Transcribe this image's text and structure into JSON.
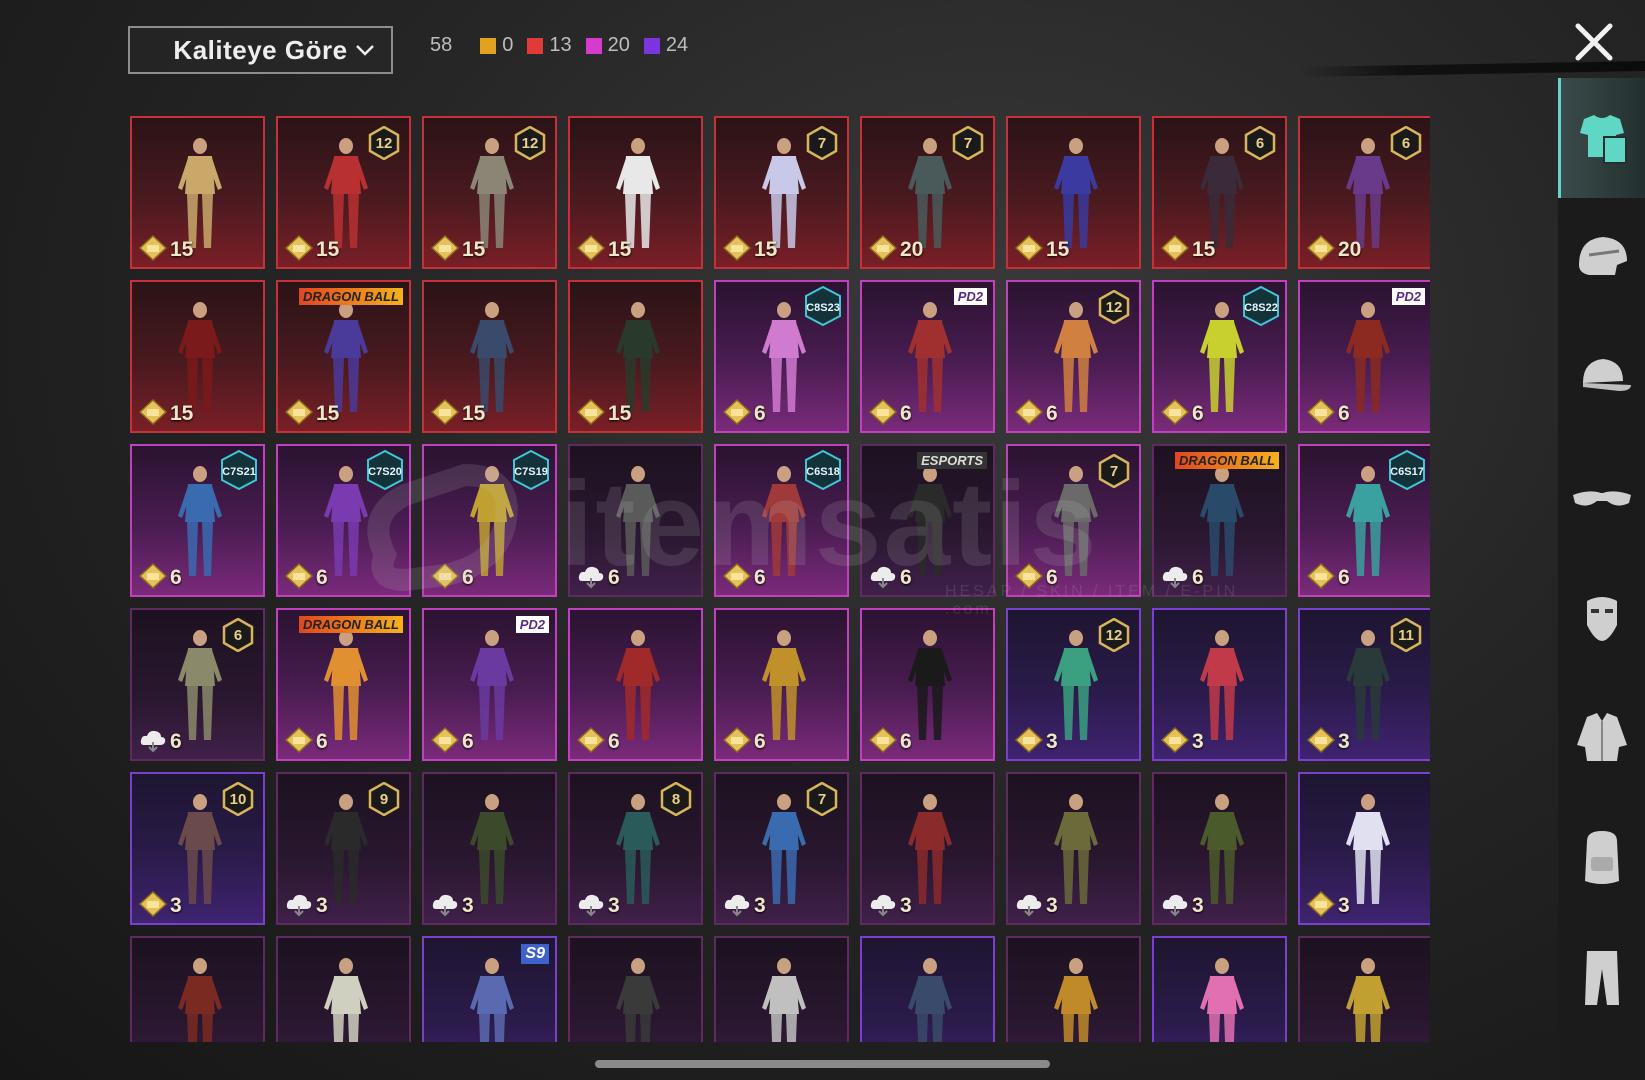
{
  "sort": {
    "label": "Kaliteye Göre"
  },
  "counts": {
    "total": "58",
    "tiers": [
      {
        "color": "#e2a11f",
        "value": "0"
      },
      {
        "color": "#e03a3a",
        "value": "13"
      },
      {
        "color": "#d63ad0",
        "value": "20"
      },
      {
        "color": "#7b35e0",
        "value": "24"
      }
    ]
  },
  "watermark": {
    "text": "itemsatis",
    "sub": "HESAP / SKIN / ITEM / E-PIN .com"
  },
  "items": [
    {
      "rarity": "red",
      "currency": "gold",
      "value": "15",
      "badge": "",
      "outfit": "#c9a86a"
    },
    {
      "rarity": "red",
      "currency": "gold",
      "value": "15",
      "badge": "12",
      "outfit": "#b83030"
    },
    {
      "rarity": "red",
      "currency": "gold",
      "value": "15",
      "badge": "12",
      "outfit": "#8a8575"
    },
    {
      "rarity": "red",
      "currency": "gold",
      "value": "15",
      "badge": "",
      "outfit": "#e8e8e8"
    },
    {
      "rarity": "red",
      "currency": "gold",
      "value": "15",
      "badge": "7",
      "outfit": "#c8c8e8"
    },
    {
      "rarity": "red",
      "currency": "gold",
      "value": "20",
      "badge": "7",
      "outfit": "#4a5a5a"
    },
    {
      "rarity": "red",
      "currency": "gold",
      "value": "15",
      "badge": "",
      "outfit": "#3a3aa0"
    },
    {
      "rarity": "red",
      "currency": "gold",
      "value": "15",
      "badge": "6",
      "outfit": "#3a2a3a"
    },
    {
      "rarity": "red",
      "currency": "gold",
      "value": "20",
      "badge": "6",
      "outfit": "#6a3a8a"
    },
    {
      "rarity": "red",
      "currency": "gold",
      "value": "15",
      "badge": "",
      "outfit": "#7a1a1a"
    },
    {
      "rarity": "red",
      "currency": "gold",
      "value": "15",
      "tag": "DRAGON BALL",
      "tagType": "dbs",
      "outfit": "#4a3a9a"
    },
    {
      "rarity": "red",
      "currency": "gold",
      "value": "15",
      "badge": "",
      "outfit": "#3a4a6a"
    },
    {
      "rarity": "red",
      "currency": "gold",
      "value": "15",
      "badge": "",
      "outfit": "#2a3a2a"
    },
    {
      "rarity": "magenta",
      "currency": "gold",
      "value": "6",
      "hex": "C8S23",
      "outfit": "#d07ad0"
    },
    {
      "rarity": "magenta",
      "currency": "gold",
      "value": "6",
      "tag": "PD2",
      "tagType": "pd",
      "outfit": "#a03030"
    },
    {
      "rarity": "magenta",
      "currency": "gold",
      "value": "6",
      "badge": "12",
      "outfit": "#d08040"
    },
    {
      "rarity": "magenta",
      "currency": "gold",
      "value": "6",
      "hex": "C8S22",
      "outfit": "#c8d030"
    },
    {
      "rarity": "magenta",
      "currency": "gold",
      "value": "6",
      "tag": "PD2",
      "tagType": "pd",
      "outfit": "#8a2a20"
    },
    {
      "rarity": "magenta",
      "currency": "gold",
      "value": "6",
      "hex": "C7S21",
      "outfit": "#3a6ab0"
    },
    {
      "rarity": "magenta",
      "currency": "gold",
      "value": "6",
      "hex": "C7S20",
      "outfit": "#7a3ab0"
    },
    {
      "rarity": "magenta",
      "currency": "gold",
      "value": "6",
      "hex": "C7S19",
      "outfit": "#c0a030"
    },
    {
      "rarity": "dark",
      "currency": "cloud",
      "value": "6",
      "badge": "",
      "outfit": "#5a5a5a"
    },
    {
      "rarity": "magenta",
      "currency": "gold",
      "value": "6",
      "hex": "C6S18",
      "outfit": "#a03a3a"
    },
    {
      "rarity": "dark",
      "currency": "cloud",
      "value": "6",
      "tag": "ESPORTS",
      "tagType": "esp",
      "outfit": "#2a2a2a"
    },
    {
      "rarity": "magenta",
      "currency": "gold",
      "value": "6",
      "badge": "7",
      "outfit": "#6a6a6a"
    },
    {
      "rarity": "dark",
      "currency": "cloud",
      "value": "6",
      "tag": "DRAGON BALL",
      "tagType": "dbs",
      "outfit": "#2a4a6a"
    },
    {
      "rarity": "magenta",
      "currency": "gold",
      "value": "6",
      "hex": "C6S17",
      "outfit": "#3aa0a0"
    },
    {
      "rarity": "dark",
      "currency": "cloud",
      "value": "6",
      "badge": "6",
      "outfit": "#8a8a6a"
    },
    {
      "rarity": "magenta",
      "currency": "gold",
      "value": "6",
      "tag": "DRAGON BALL",
      "tagType": "dbs",
      "outfit": "#e09030"
    },
    {
      "rarity": "magenta",
      "currency": "gold",
      "value": "6",
      "tag": "PD2",
      "tagType": "pd",
      "outfit": "#6a3aa0"
    },
    {
      "rarity": "magenta",
      "currency": "gold",
      "value": "6",
      "badge": "",
      "outfit": "#a02a2a"
    },
    {
      "rarity": "magenta",
      "currency": "gold",
      "value": "6",
      "badge": "",
      "outfit": "#c0902a"
    },
    {
      "rarity": "magenta",
      "currency": "gold",
      "value": "6",
      "badge": "",
      "outfit": "#1a1a1a"
    },
    {
      "rarity": "purple",
      "currency": "gold",
      "value": "3",
      "badge": "12",
      "outfit": "#3aa080"
    },
    {
      "rarity": "purple",
      "currency": "gold",
      "value": "3",
      "badge": "",
      "outfit": "#c03a4a"
    },
    {
      "rarity": "purple",
      "currency": "gold",
      "value": "3",
      "badge": "11",
      "outfit": "#2a3a3a"
    },
    {
      "rarity": "purple",
      "currency": "gold",
      "value": "3",
      "badge": "10",
      "outfit": "#6a4a4a"
    },
    {
      "rarity": "dark",
      "currency": "cloud",
      "value": "3",
      "badge": "9",
      "outfit": "#2a2a2a"
    },
    {
      "rarity": "dark",
      "currency": "cloud",
      "value": "3",
      "badge": "",
      "outfit": "#3a4a2a"
    },
    {
      "rarity": "dark",
      "currency": "cloud",
      "value": "3",
      "badge": "8",
      "outfit": "#2a5a5a"
    },
    {
      "rarity": "dark",
      "currency": "cloud",
      "value": "3",
      "badge": "7",
      "outfit": "#3a6ab0"
    },
    {
      "rarity": "dark",
      "currency": "cloud",
      "value": "3",
      "badge": "",
      "outfit": "#8a2a2a"
    },
    {
      "rarity": "dark",
      "currency": "cloud",
      "value": "3",
      "badge": "",
      "outfit": "#6a6a3a"
    },
    {
      "rarity": "dark",
      "currency": "cloud",
      "value": "3",
      "badge": "",
      "outfit": "#4a5a2a"
    },
    {
      "rarity": "purple",
      "currency": "gold",
      "value": "3",
      "badge": "",
      "outfit": "#e0e0f0"
    },
    {
      "rarity": "dark",
      "currency": "",
      "value": "",
      "badge": "",
      "outfit": "#7a2a20"
    },
    {
      "rarity": "dark",
      "currency": "",
      "value": "",
      "badge": "",
      "outfit": "#d0d0c0"
    },
    {
      "rarity": "purple",
      "currency": "",
      "value": "",
      "tag": "S9",
      "tagType": "s9",
      "outfit": "#5a6ab0"
    },
    {
      "rarity": "dark",
      "currency": "",
      "value": "",
      "badge": "",
      "outfit": "#3a3a3a"
    },
    {
      "rarity": "dark",
      "currency": "",
      "value": "",
      "badge": "",
      "outfit": "#c0c0c0"
    },
    {
      "rarity": "purple",
      "currency": "",
      "value": "",
      "badge": "",
      "outfit": "#3a4a6a"
    },
    {
      "rarity": "dark",
      "currency": "",
      "value": "",
      "badge": "",
      "outfit": "#c08a2a"
    },
    {
      "rarity": "purple",
      "currency": "",
      "value": "",
      "badge": "",
      "outfit": "#e070b0"
    },
    {
      "rarity": "dark",
      "currency": "",
      "value": "",
      "badge": "",
      "outfit": "#c0a030"
    }
  ],
  "sidebar": [
    {
      "name": "outfit-icon",
      "active": true
    },
    {
      "name": "helmet-icon",
      "active": false
    },
    {
      "name": "cap-icon",
      "active": false
    },
    {
      "name": "glasses-icon",
      "active": false
    },
    {
      "name": "mask-icon",
      "active": false
    },
    {
      "name": "jacket-icon",
      "active": false
    },
    {
      "name": "backpack-icon",
      "active": false
    },
    {
      "name": "pants-icon",
      "active": false
    }
  ]
}
